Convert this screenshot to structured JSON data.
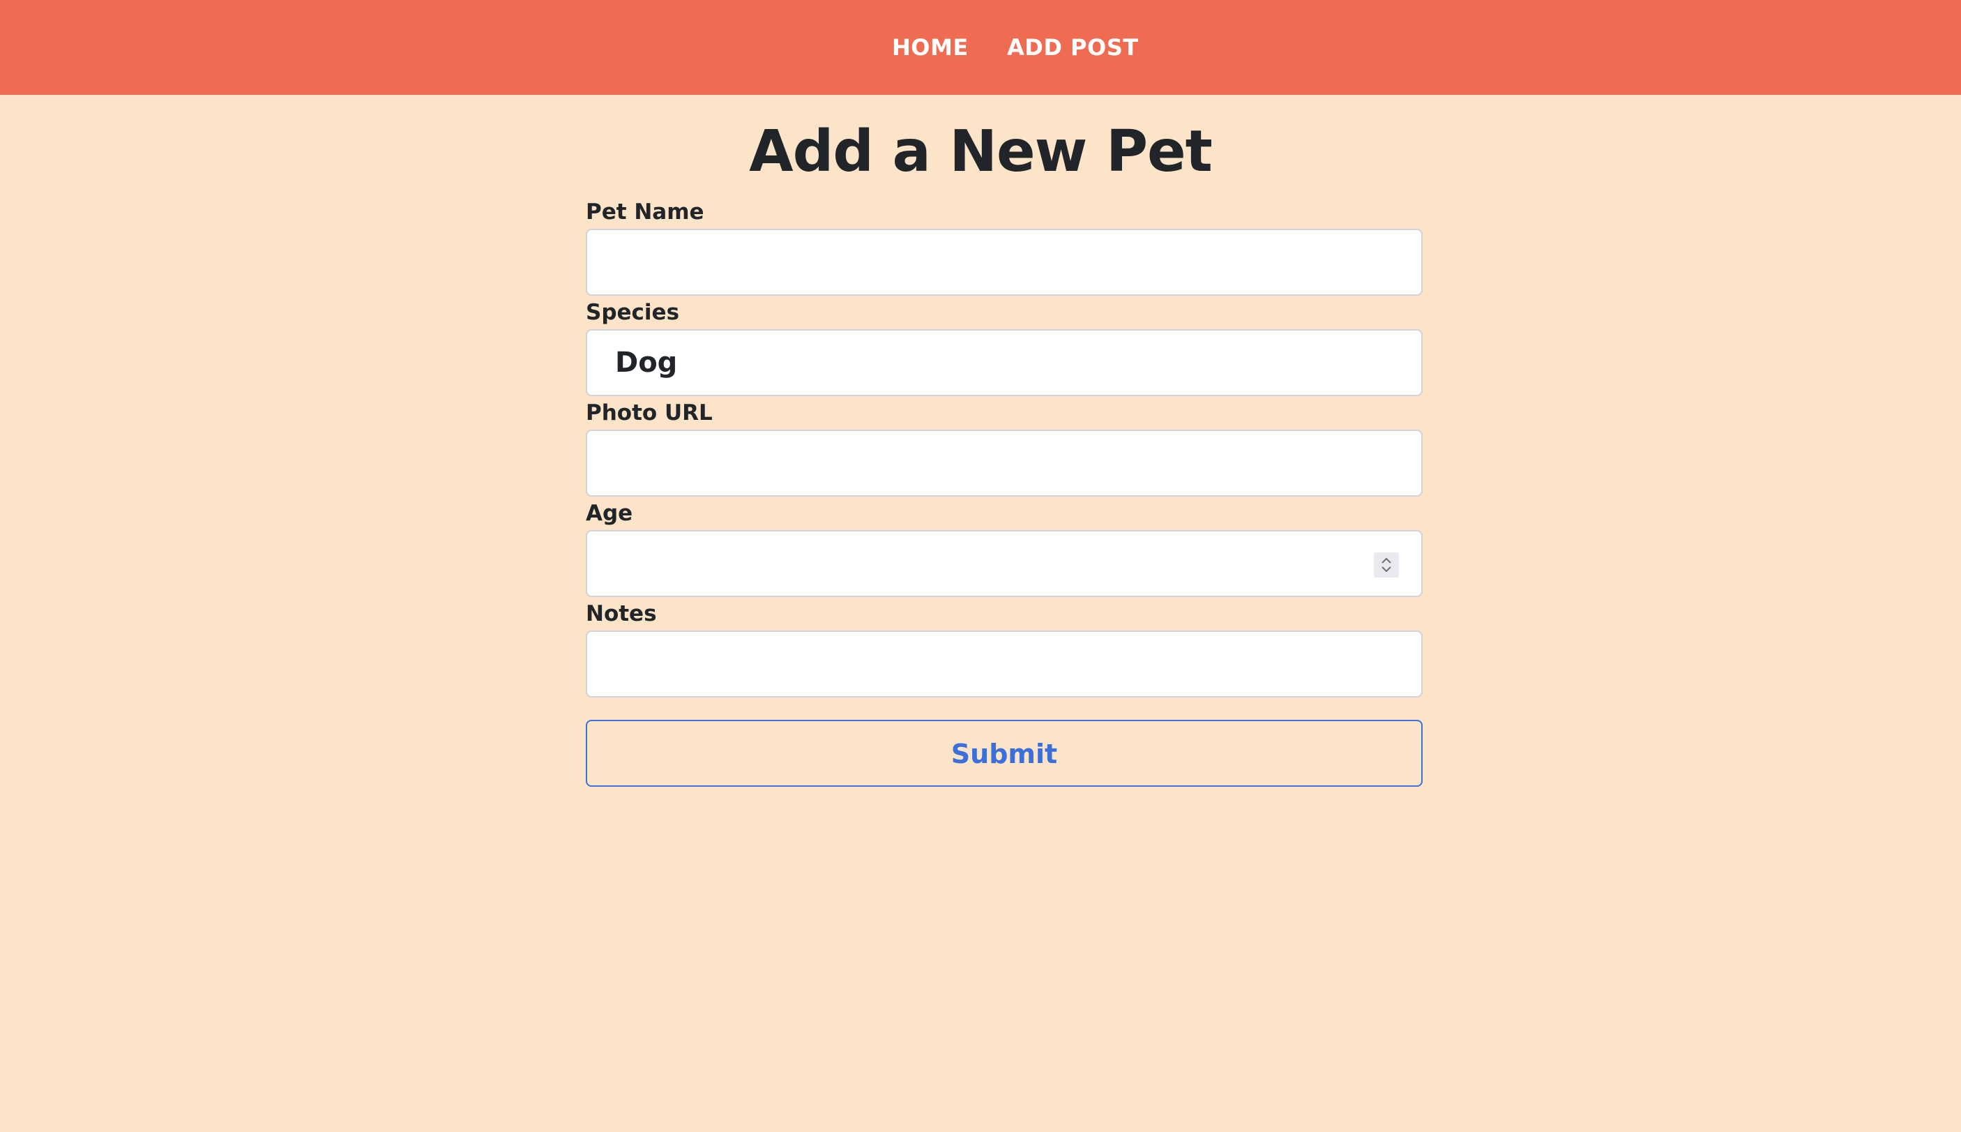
{
  "nav": {
    "home_label": "HOME",
    "add_post_label": "ADD POST"
  },
  "page": {
    "title": "Add a New Pet"
  },
  "form": {
    "pet_name": {
      "label": "Pet Name",
      "value": ""
    },
    "species": {
      "label": "Species",
      "selected": "Dog"
    },
    "photo_url": {
      "label": "Photo URL",
      "value": ""
    },
    "age": {
      "label": "Age",
      "value": ""
    },
    "notes": {
      "label": "Notes",
      "value": ""
    },
    "submit_label": "Submit"
  },
  "colors": {
    "navbar_bg": "#ef6c52",
    "page_bg": "#fbe4c7",
    "accent": "#3a6fdc",
    "text": "#212529"
  }
}
